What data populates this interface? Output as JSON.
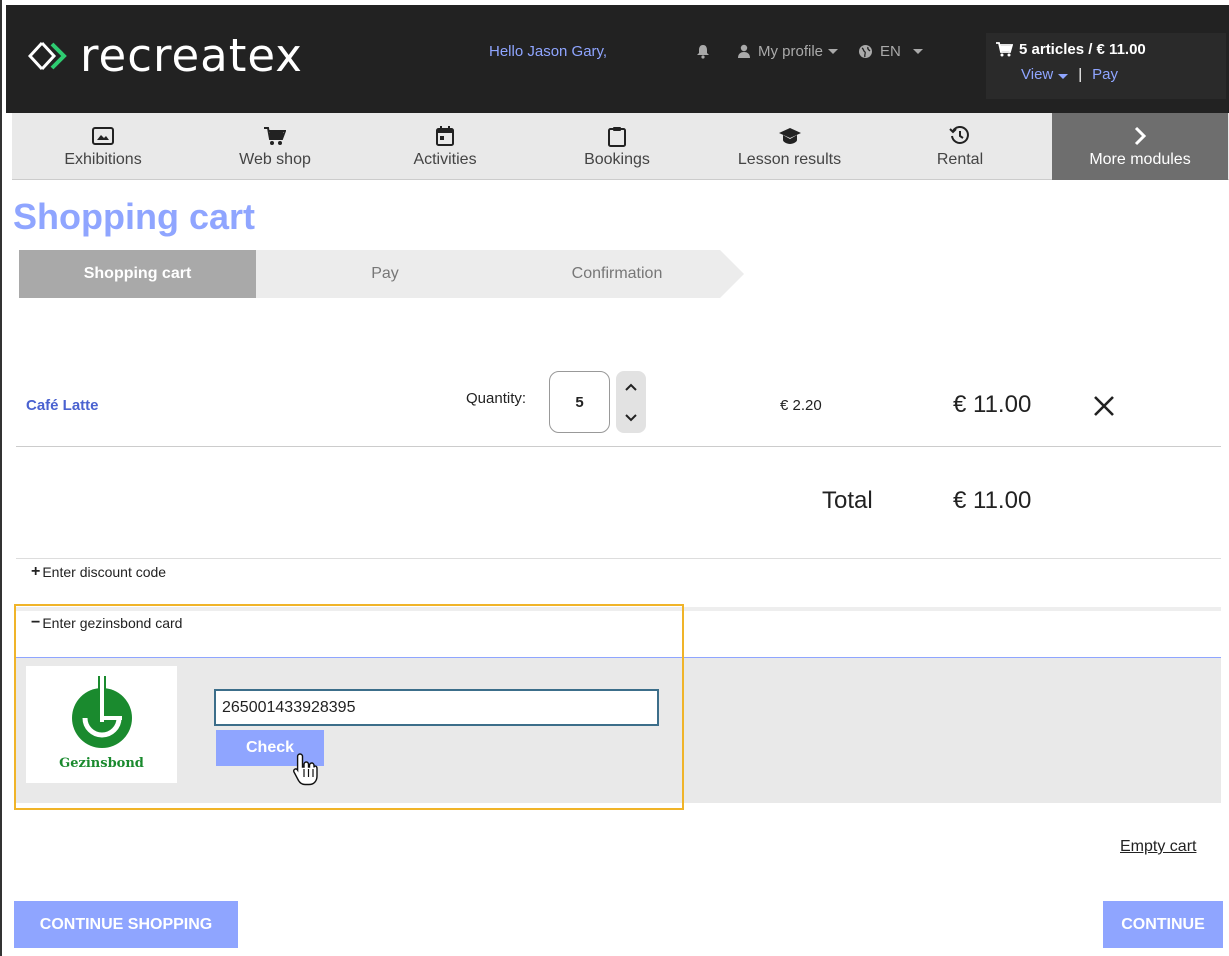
{
  "brand": {
    "name": "recreatex"
  },
  "header": {
    "greeting": "Hello Jason Gary,",
    "profile_label": "My profile",
    "language": "EN",
    "cart_summary": "5 articles / € 11.00",
    "view_label": "View",
    "pay_label": "Pay",
    "icons": [
      "bell-icon",
      "user-icon",
      "globe-icon",
      "cart-icon"
    ]
  },
  "nav": {
    "items": [
      {
        "label": "Exhibitions",
        "icon": "image-icon"
      },
      {
        "label": "Web shop",
        "icon": "cart-icon"
      },
      {
        "label": "Activities",
        "icon": "calendar-icon"
      },
      {
        "label": "Bookings",
        "icon": "clipboard-icon"
      },
      {
        "label": "Lesson results",
        "icon": "graduation-cap-icon"
      },
      {
        "label": "Rental",
        "icon": "history-icon"
      }
    ],
    "more_label": "More modules"
  },
  "page": {
    "title": "Shopping cart"
  },
  "steps": [
    {
      "label": "Shopping cart",
      "active": true
    },
    {
      "label": "Pay",
      "active": false
    },
    {
      "label": "Confirmation",
      "active": false
    }
  ],
  "cart": {
    "items": [
      {
        "name": "Café Latte",
        "quantity_label": "Quantity:",
        "quantity": "5",
        "unit_price": "€ 2.20",
        "line_total": "€ 11.00"
      }
    ],
    "total_label": "Total",
    "total_value": "€ 11.00"
  },
  "discount": {
    "toggle": "+",
    "label": "Enter discount code"
  },
  "gezinsbond": {
    "toggle": "−",
    "label": "Enter gezinsbond card",
    "logo_text": "Gezinsbond",
    "card_number": "265001433928395",
    "check_label": "Check"
  },
  "actions": {
    "empty_cart": "Empty cart",
    "continue_shopping": "CONTINUE SHOPPING",
    "continue": "CONTINUE"
  },
  "colors": {
    "accent": "#8fa5ff",
    "header_bg": "#222222",
    "highlight": "#f0b429",
    "brand_green": "#1a8a2e"
  }
}
